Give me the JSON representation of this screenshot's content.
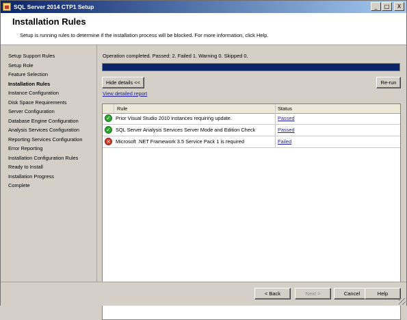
{
  "window": {
    "title": "SQL Server 2014 CTP1 Setup",
    "minimize": "_",
    "maximize": "□",
    "close": "X"
  },
  "header": {
    "title": "Installation Rules",
    "subtitle": "Setup is running rules to determine if the installation process will be blocked. For more information, click Help."
  },
  "steps": [
    {
      "label": "Setup Support Rules",
      "active": false
    },
    {
      "label": "Setup Role",
      "active": false
    },
    {
      "label": "Feature Selection",
      "active": false
    },
    {
      "label": "Installation Rules",
      "active": true
    },
    {
      "label": "Instance Configuration",
      "active": false
    },
    {
      "label": "Disk Space Requirements",
      "active": false
    },
    {
      "label": "Server Configuration",
      "active": false
    },
    {
      "label": "Database Engine Configuration",
      "active": false
    },
    {
      "label": "Analysis Services Configuration",
      "active": false
    },
    {
      "label": "Reporting Services Configuration",
      "active": false
    },
    {
      "label": "Error Reporting",
      "active": false
    },
    {
      "label": "Installation Configuration Rules",
      "active": false
    },
    {
      "label": "Ready to Install",
      "active": false
    },
    {
      "label": "Installation Progress",
      "active": false
    },
    {
      "label": "Complete",
      "active": false
    }
  ],
  "main": {
    "operation_status": "Operation completed. Passed: 2.   Failed 1.   Warning 0.   Skipped 0.",
    "progress_fraction": 1.0,
    "hide_details": "Hide details <<",
    "rerun": "Re-run",
    "view_report": "View detailed report",
    "columns": {
      "rule": "Rule",
      "status": "Status"
    },
    "rules": [
      {
        "rule": "Prior Visual Studio 2010 instances requiring update.",
        "status": "Passed",
        "result": "pass"
      },
      {
        "rule": "SQL Server Analysis Services Server Mode and Edition Check",
        "status": "Passed",
        "result": "pass"
      },
      {
        "rule": "Microsoft .NET Framework 3.5 Service Pack 1 is required",
        "status": "Failed",
        "result": "fail"
      }
    ]
  },
  "footer": {
    "back": "< Back",
    "next": "Next >",
    "cancel": "Cancel",
    "help": "Help"
  },
  "icons": {
    "pass": "green-check-icon",
    "fail": "red-x-icon"
  },
  "colors": {
    "title_bar": "#0a246a",
    "progress": "#0a246a",
    "link": "#1a1aa6"
  }
}
